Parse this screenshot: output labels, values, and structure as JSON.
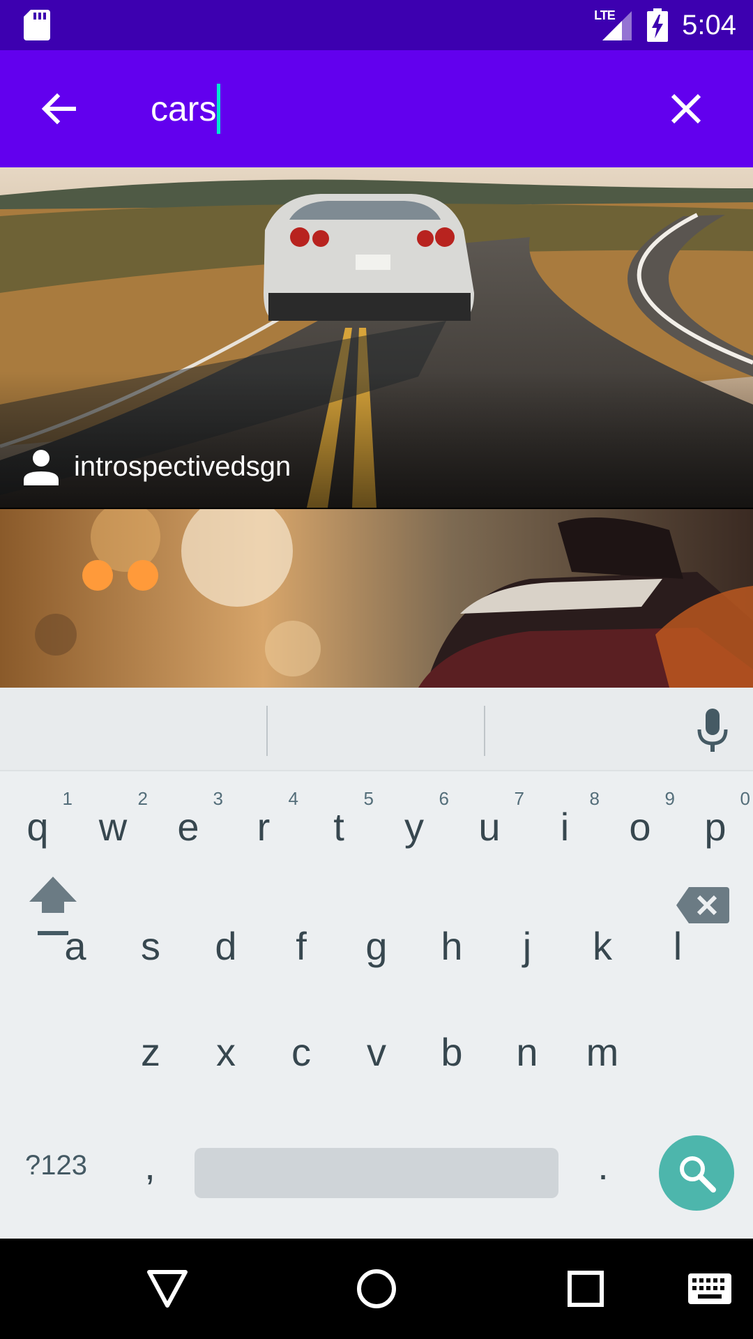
{
  "status_bar": {
    "network": "LTE",
    "time": "5:04",
    "icons": [
      "sd-card-icon",
      "signal-icon",
      "battery-charging-icon"
    ]
  },
  "app_bar": {
    "query": "cars",
    "icons": [
      "back-arrow-icon",
      "close-icon"
    ]
  },
  "results": [
    {
      "author": "introspectivedsgn",
      "icon": "person-icon"
    },
    {
      "author": ""
    }
  ],
  "keyboard": {
    "row1": [
      {
        "k": "q",
        "h": "1"
      },
      {
        "k": "w",
        "h": "2"
      },
      {
        "k": "e",
        "h": "3"
      },
      {
        "k": "r",
        "h": "4"
      },
      {
        "k": "t",
        "h": "5"
      },
      {
        "k": "y",
        "h": "6"
      },
      {
        "k": "u",
        "h": "7"
      },
      {
        "k": "i",
        "h": "8"
      },
      {
        "k": "o",
        "h": "9"
      },
      {
        "k": "p",
        "h": "0"
      }
    ],
    "row2": [
      "a",
      "s",
      "d",
      "f",
      "g",
      "h",
      "j",
      "k",
      "l"
    ],
    "row3": [
      "z",
      "x",
      "c",
      "v",
      "b",
      "n",
      "m"
    ],
    "symbols_label": "?123",
    "comma": ",",
    "period": ".",
    "icons": [
      "mic-icon",
      "shift-icon",
      "backspace-icon",
      "search-icon"
    ]
  },
  "nav_bar": {
    "icons": [
      "back-triangle-icon",
      "home-circle-icon",
      "recents-square-icon",
      "keyboard-icon"
    ]
  },
  "colors": {
    "status_bar": "#3d00b0",
    "app_bar": "#6200ee",
    "caret": "#00e5d0",
    "search_key": "#4db6ac",
    "keyboard_bg": "#eceff1"
  }
}
